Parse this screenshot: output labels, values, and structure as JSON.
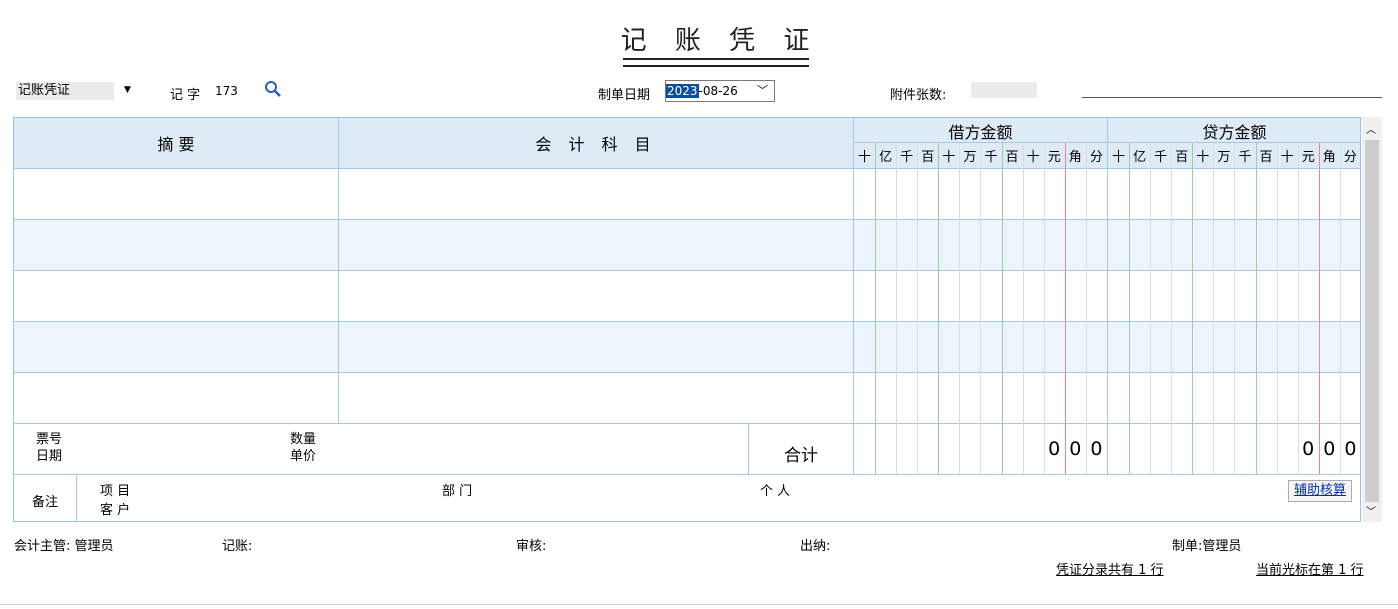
{
  "title": "记 账 凭 证",
  "toolbar": {
    "voucher_type": "记账凭证",
    "voucher_word": "记 字",
    "voucher_number": "173",
    "date_label": "制单日期",
    "date_year": "2023",
    "date_rest": "-08-26",
    "attachments_label": "附件张数:"
  },
  "table": {
    "col_summary": "摘    要",
    "col_account": "会 计 科 目",
    "debit_header": "借方金额",
    "credit_header": "贷方金额",
    "digits": [
      "十",
      "亿",
      "千",
      "百",
      "十",
      "万",
      "千",
      "百",
      "十",
      "元",
      "角",
      "分"
    ],
    "rows": [
      "",
      "",
      "",
      "",
      ""
    ]
  },
  "info": {
    "ticket_no": "票号",
    "date": "日期",
    "quantity": "数量",
    "unit_price": "单价",
    "total": "合计",
    "debit_total": [
      "0",
      "0",
      "0"
    ],
    "credit_total": [
      "0",
      "0",
      "0"
    ]
  },
  "notes": {
    "remark": "备注",
    "project": "项 目",
    "customer": "客 户",
    "department": "部 门",
    "person": "个 人",
    "aux_button": "辅助核算"
  },
  "footer": {
    "chief": "会计主管: 管理员",
    "bookkeeper": "记账:",
    "auditor": "审核:",
    "cashier": "出纳:",
    "maker": "制单:管理员",
    "entry_count": "凭证分录共有 1 行",
    "cursor_row": "当前光标在第 1 行"
  }
}
